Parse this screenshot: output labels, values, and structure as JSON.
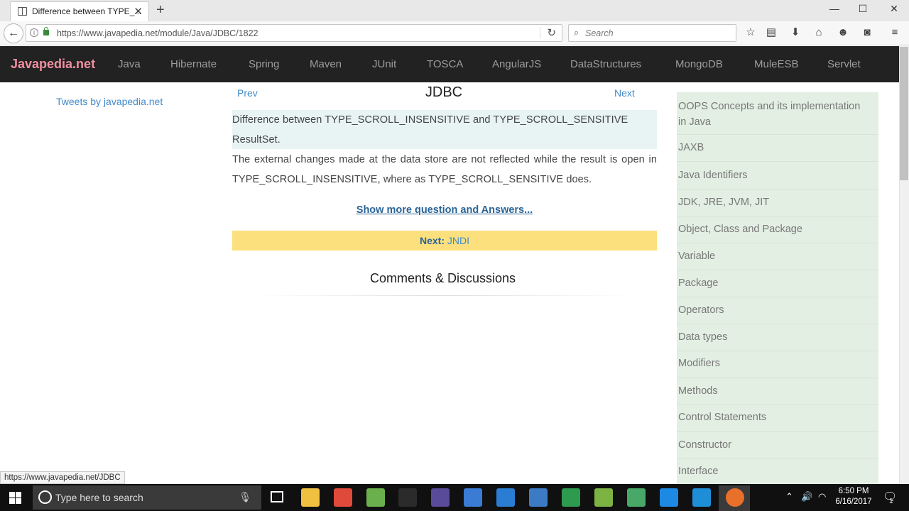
{
  "browser": {
    "tab_title": "Difference between TYPE_...",
    "url": "https://www.javapedia.net/module/Java/JDBC/1822",
    "search_placeholder": "Search",
    "status_url": "https://www.javapedia.net/JDBC",
    "new_tab": "+",
    "close": "✕",
    "minimize": "—",
    "maximize": "☐",
    "window_close": "✕"
  },
  "site": {
    "brand": "Javapedia.net",
    "nav": [
      "Java",
      "Hibernate",
      "Spring",
      "Maven",
      "JUnit",
      "TOSCA",
      "AngularJS",
      "DataStructures",
      "MongoDB",
      "MuleESB",
      "Servlet"
    ]
  },
  "left": {
    "tweets": "Tweets by javapedia.net"
  },
  "main": {
    "prev": "Prev",
    "title": "JDBC",
    "next": "Next",
    "question": "Difference between TYPE_SCROLL_INSENSITIVE and TYPE_SCROLL_SENSITIVE ResultSet.",
    "answer": "The external changes made at the data store are not reflected while the result is open in TYPE_SCROLL_INSENSITIVE, where as TYPE_SCROLL_SENSITIVE does.",
    "show_more": "Show more question and Answers...",
    "next_label": "Next:",
    "next_value": "JNDI",
    "comments_heading": "Comments & Discussions"
  },
  "sidebar": {
    "items": [
      "OOPS Concepts and its implementation in Java",
      "JAXB",
      "Java Identifiers",
      "JDK, JRE, JVM, JIT",
      "Object, Class and Package",
      "Variable",
      "Package",
      "Operators",
      "Data types",
      "Modifiers",
      "Methods",
      "Control Statements",
      "Constructor",
      "Interface"
    ]
  },
  "taskbar": {
    "search_placeholder": "Type here to search",
    "time": "6:50 PM",
    "date": "6/16/2017",
    "notification_count": "1",
    "apps": [
      {
        "name": "file-explorer",
        "color": "#f0c040"
      },
      {
        "name": "chrome",
        "color": "#e04a3a"
      },
      {
        "name": "app-green",
        "color": "#6ab04c"
      },
      {
        "name": "terminal",
        "color": "#2b2b2b"
      },
      {
        "name": "eclipse",
        "color": "#5a4a9a"
      },
      {
        "name": "app-blue",
        "color": "#3a7bd5"
      },
      {
        "name": "mail",
        "color": "#2b7cd3"
      },
      {
        "name": "visual-studio",
        "color": "#3c7bc4"
      },
      {
        "name": "app-leaf",
        "color": "#2e9a4e"
      },
      {
        "name": "notepad",
        "color": "#7cb342"
      },
      {
        "name": "photos",
        "color": "#48a868"
      },
      {
        "name": "edge",
        "color": "#1e88e5"
      },
      {
        "name": "mulesoft",
        "color": "#1e8fd6"
      },
      {
        "name": "firefox",
        "color": "#e8702a"
      }
    ]
  }
}
